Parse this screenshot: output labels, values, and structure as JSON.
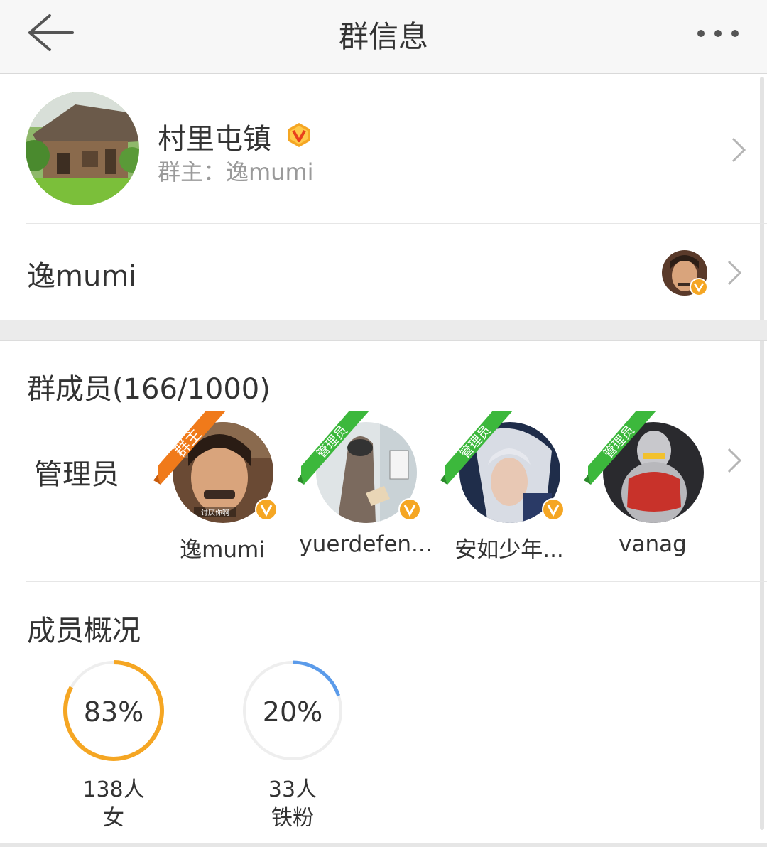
{
  "header": {
    "title": "群信息",
    "back_icon": "back-arrow-icon",
    "more_icon": "more-dots-icon"
  },
  "group": {
    "name": "村里屯镇",
    "owner_line": "群主：逸mumi",
    "badge_icon": "vip-v-icon",
    "badge_color": "#f5a623"
  },
  "owner": {
    "name": "逸mumi"
  },
  "members": {
    "title": "群成员(166/1000)",
    "admins_label": "管理员",
    "list": [
      {
        "name": "逸mumi",
        "role": "群主",
        "role_color": "#f07a1a"
      },
      {
        "name": "yuerdefen...",
        "role": "管理员",
        "role_color": "#3cb83c"
      },
      {
        "name": "安如少年...",
        "role": "管理员",
        "role_color": "#3cb83c"
      },
      {
        "name": "vanag",
        "role": "管理员",
        "role_color": "#3cb83c"
      }
    ]
  },
  "overview": {
    "title": "成员概况",
    "stats": [
      {
        "percent": "83%",
        "value": 0.83,
        "count": "138人",
        "label": "女",
        "color": "#f5a623"
      },
      {
        "percent": "20%",
        "value": 0.2,
        "count": "33人",
        "label": "铁粉",
        "color": "#5b9bea"
      }
    ]
  },
  "colors": {
    "accent_orange": "#f5a623",
    "admin_green": "#3cb83c",
    "owner_orange": "#f07a1a"
  }
}
